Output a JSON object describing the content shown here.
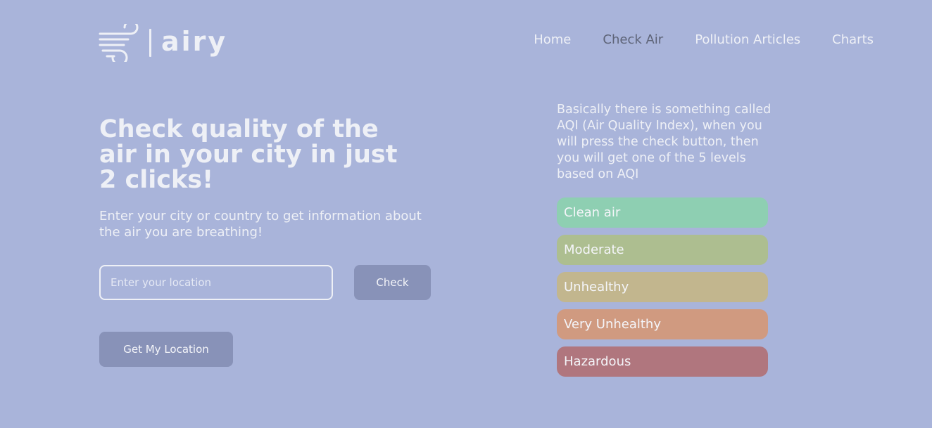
{
  "brand": {
    "name": "airy"
  },
  "nav": {
    "items": [
      {
        "label": "Home"
      },
      {
        "label": "Check Air"
      },
      {
        "label": "Pollution Articles"
      },
      {
        "label": "Charts"
      }
    ]
  },
  "hero": {
    "title": "Check quality of the air in your city in just 2 clicks!",
    "subtitle": "Enter your city or country to get information about the air you are breathing!"
  },
  "search": {
    "placeholder": "Enter your location",
    "value": "",
    "check_label": "Check",
    "get_location_label": "Get My Location"
  },
  "info": {
    "text": "Basically there is something called AQI (Air Quality Index), when you will press the check button, then you will get one of the 5 levels based on AQI"
  },
  "levels": [
    {
      "label": "Clean air",
      "color": "#8ecfb2"
    },
    {
      "label": "Moderate",
      "color": "#adbe90"
    },
    {
      "label": "Unhealthy",
      "color": "#c2b68e"
    },
    {
      "label": "Very Unhealthy",
      "color": "#d09a80"
    },
    {
      "label": "Hazardous",
      "color": "#b0767e"
    }
  ],
  "icons": {
    "logo": "wind-icon"
  },
  "colors": {
    "background": "#a9b4da",
    "text": "#eef0f6",
    "nav_active": "#5e6478",
    "button": "#8892b8"
  }
}
